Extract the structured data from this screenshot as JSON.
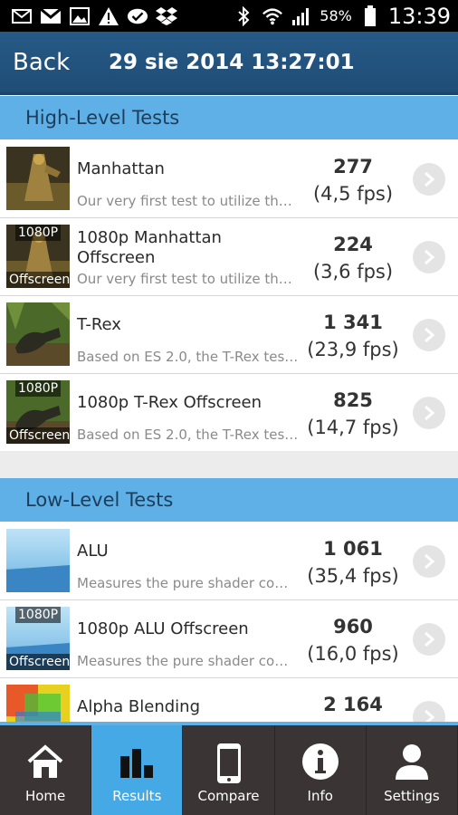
{
  "status_bar": {
    "battery_percent": "58%",
    "time": "13:39",
    "icons": [
      "mail-icon",
      "gmail-icon",
      "gallery-icon",
      "warning-icon",
      "checkmark-icon",
      "dropbox-icon",
      "bluetooth-icon",
      "wifi-icon",
      "signal-icon",
      "battery-icon"
    ]
  },
  "header": {
    "back_label": "Back",
    "title": "29 sie 2014 13:27:01"
  },
  "sections": {
    "high_level": "High-Level Tests",
    "low_level": "Low-Level Tests"
  },
  "high_level_tests": [
    {
      "name": "Manhattan",
      "description": "Our very first test to utilize the…",
      "score": "277",
      "fps": "(4,5 fps)",
      "badge_top": "",
      "badge_bottom": ""
    },
    {
      "name": "1080p Manhattan Offscreen",
      "description": "Our very first test to utilize the…",
      "score": "224",
      "fps": "(3,6 fps)",
      "badge_top": "1080P",
      "badge_bottom": "Offscreen"
    },
    {
      "name": "T-Rex",
      "description": "Based on ES 2.0, the T-Rex tes…",
      "score": "1 341",
      "fps": "(23,9 fps)",
      "badge_top": "",
      "badge_bottom": ""
    },
    {
      "name": "1080p T-Rex Offscreen",
      "description": "Based on ES 2.0, the T-Rex tes…",
      "score": "825",
      "fps": "(14,7 fps)",
      "badge_top": "1080P",
      "badge_bottom": "Offscreen"
    }
  ],
  "low_level_tests": [
    {
      "name": "ALU",
      "description": "Measures the pure shader co…",
      "score": "1 061",
      "fps": "(35,4 fps)",
      "badge_top": "",
      "badge_bottom": ""
    },
    {
      "name": "1080p ALU Offscreen",
      "description": "Measures the pure shader co…",
      "score": "960",
      "fps": "(16,0 fps)",
      "badge_top": "1080P",
      "badge_bottom": "Offscreen"
    },
    {
      "name": "Alpha Blending",
      "description": "",
      "score": "2 164",
      "fps": "",
      "badge_top": "",
      "badge_bottom": ""
    }
  ],
  "bottom_nav": [
    {
      "label": "Home",
      "icon": "home-icon",
      "active": false
    },
    {
      "label": "Results",
      "icon": "bar-chart-icon",
      "active": true
    },
    {
      "label": "Compare",
      "icon": "phone-icon",
      "active": false
    },
    {
      "label": "Info",
      "icon": "info-icon",
      "active": false
    },
    {
      "label": "Settings",
      "icon": "person-icon",
      "active": false
    }
  ],
  "colors": {
    "header": "#265a87",
    "section": "#5fb0e6",
    "nav_bg": "#3a3534",
    "nav_active": "#45a9e6"
  }
}
